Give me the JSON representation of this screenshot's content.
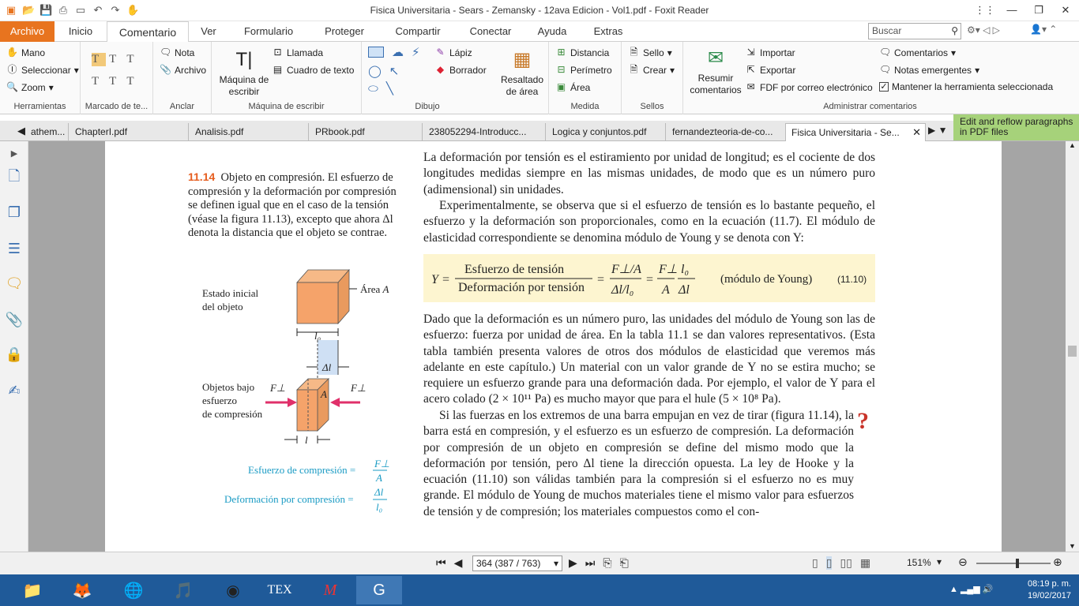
{
  "window": {
    "title": "Fisica Universitaria - Sears - Zemansky - 12ava Edicion - Vol1.pdf - Foxit Reader"
  },
  "ribbon_tabs": [
    "Archivo",
    "Inicio",
    "Comentario",
    "Ver",
    "Formulario",
    "Proteger",
    "Compartir",
    "Conectar",
    "Ayuda",
    "Extras"
  ],
  "search": {
    "placeholder": "Buscar"
  },
  "ribbon": {
    "herramientas": {
      "label": "Herramientas",
      "items": [
        "Mano",
        "Seleccionar",
        "Zoom"
      ]
    },
    "marcado": {
      "label": "Marcado de te..."
    },
    "anclar": {
      "label": "Anclar",
      "items": [
        "Nota",
        "Archivo"
      ]
    },
    "maquina": {
      "label": "Máquina de escribir",
      "big": "Máquina de escribir",
      "items": [
        "Llamada",
        "Cuadro de texto"
      ]
    },
    "dibujo": {
      "label": "Dibujo",
      "items": [
        "Lápiz",
        "Borrador"
      ]
    },
    "resaltado": {
      "big": "Resaltado de área"
    },
    "medida": {
      "label": "Medida",
      "items": [
        "Distancia",
        "Perímetro",
        "Área"
      ]
    },
    "sellos": {
      "label": "Sellos",
      "items": [
        "Sello",
        "Crear"
      ]
    },
    "administrar": {
      "label": "Administrar comentarios",
      "big": "Resumir comentarios",
      "items": [
        "Importar",
        "Exportar",
        "FDF por correo electrónico",
        "Comentarios",
        "Notas emergentes",
        "Mantener la herramienta seleccionada"
      ]
    }
  },
  "doc_tabs": [
    "athem...",
    "ChapterI.pdf",
    "Analisis.pdf",
    "PRbook.pdf",
    "238052294-Introducc...",
    "Logica y conjuntos.pdf",
    "fernandezteoria-de-co...",
    "Fisica Universitaria - Se..."
  ],
  "reflow_banner": "Edit and reflow paragraphs in PDF files",
  "page": {
    "para1": "La deformación por tensión es el estiramiento por unidad de longitud; es el cociente de dos longitudes medidas siempre en las mismas unidades, de modo que es un número puro (adimensional) sin unidades.",
    "para2": "Experimentalmente, se observa que si el esfuerzo de tensión es lo bastante pequeño, el esfuerzo y la deformación son proporcionales, como en la ecuación (11.7). El módulo de elasticidad correspondiente se denomina módulo de Young y se denota con Y:",
    "eq_num": "(11.10)",
    "eq_label": "(módulo de Young)",
    "eq_num_top": "Esfuerzo de tensión",
    "eq_den": "Deformación por tensión",
    "para3": "Dado que la deformación es un número puro, las unidades del módulo de Young son las de esfuerzo: fuerza por unidad de área. En la tabla 11.1 se dan valores representativos. (Esta tabla también presenta valores de otros dos módulos de elasticidad que veremos más adelante en este capítulo.) Un material con un valor grande de Y no se estira mucho; se requiere un esfuerzo grande para una deformación dada. Por ejemplo, el valor de Y para el acero colado (2 × 10¹¹ Pa) es mucho mayor que para el hule (5 × 10⁸ Pa).",
    "para4": "Si las fuerzas en los extremos de una barra empujan en vez de tirar (figura 11.14), la barra está en compresión, y el esfuerzo es un esfuerzo de compresión. La deformación por compresión de un objeto en compresión se define del mismo modo que la deformación por tensión, pero Δl tiene la dirección opuesta. La ley de Hooke y la ecuación (11.10) son válidas también para la compresión si el esfuerzo no es muy grande. El módulo de Young de muchos materiales tiene el mismo valor para esfuerzos de tensión y de compresión; los materiales compuestos como el con-",
    "caption_num": "11.14",
    "caption": "Objeto en compresión. El esfuerzo de compresión y la deformación por compresión se definen igual que en el caso de la tensión (véase la figura 11.13), excepto que ahora Δl denota la distancia que el objeto se contrae.",
    "fig": {
      "estado": "Estado inicial del objeto",
      "area": "Área A",
      "l0": "l0",
      "dl": "Δl",
      "objetos": "Objetos bajo esfuerzo de compresión",
      "f1": "F⊥",
      "f2": "F⊥",
      "a": "A",
      "l": "l",
      "esf": "Esfuerzo de compresión =",
      "def": "Deformación por compresión ="
    }
  },
  "status": {
    "page": "364 (387 / 763)",
    "zoom": "151%"
  },
  "clock": {
    "time": "08:19 p. m.",
    "date": "19/02/2017"
  }
}
